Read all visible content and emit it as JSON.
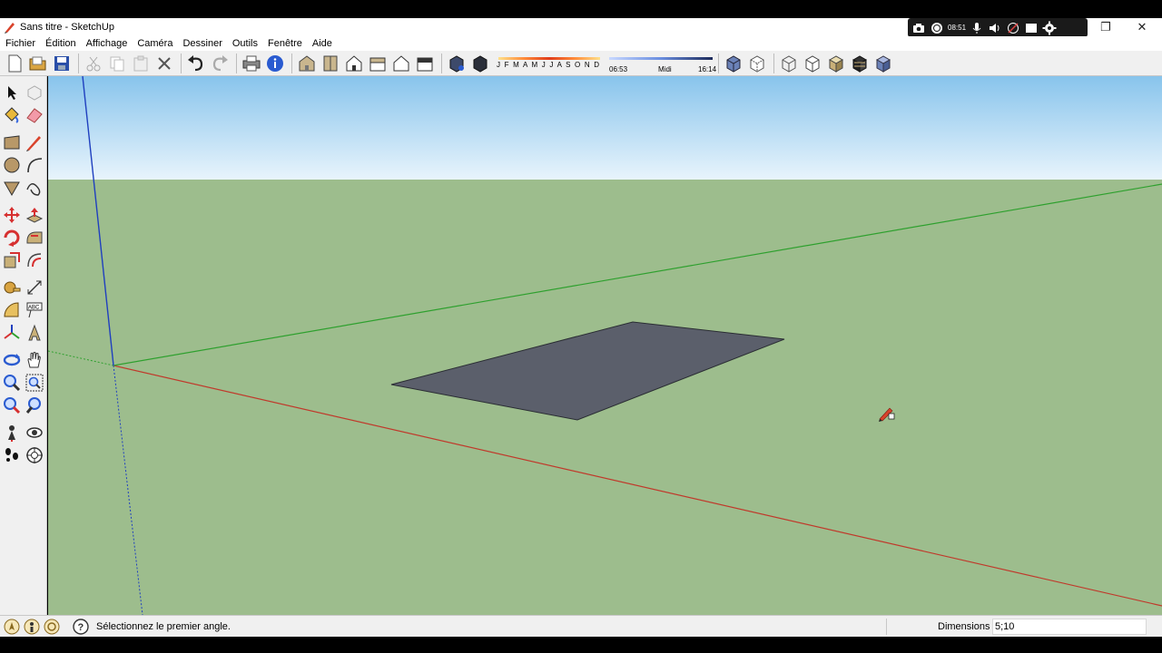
{
  "window": {
    "title": "Sans titre - SketchUp",
    "recorder_time": "08:51",
    "minimize": "—",
    "restore": "❐",
    "close": "✕"
  },
  "menu": [
    "Fichier",
    "Édition",
    "Affichage",
    "Caméra",
    "Dessiner",
    "Outils",
    "Fenêtre",
    "Aide"
  ],
  "shadow": {
    "months": "J F M A M J J A S O N D",
    "sunrise": "06:53",
    "noon": "Midi",
    "sunset": "16:14"
  },
  "toolbar_icons": [
    "new-icon",
    "open-icon",
    "save-icon",
    "cut-icon",
    "copy-icon",
    "paste-icon",
    "erase-icon",
    "undo-icon",
    "redo-icon",
    "print-icon",
    "model-info-icon",
    "iso-view-icon",
    "top-view-icon",
    "front-view-icon",
    "right-view-icon",
    "back-view-icon",
    "left-view-icon",
    "xray-icon",
    "back-edges-icon",
    "wireframe-icon",
    "hidden-line-icon",
    "shaded-icon",
    "shaded-textures-icon",
    "monochrome-icon",
    "section-icon",
    "component-icon"
  ],
  "status": {
    "message": "Sélectionnez le premier angle.",
    "dimensions_label": "Dimensions",
    "dimensions_value": "5;10"
  },
  "colors": {
    "sky_top": "#88c4ec",
    "sky_bottom": "#e8f4fc",
    "ground": "#9dbd8d",
    "face": "#5b5f6b",
    "axis_red": "#c0392b",
    "axis_green": "#2ea02e",
    "axis_blue": "#1f3fbf"
  }
}
